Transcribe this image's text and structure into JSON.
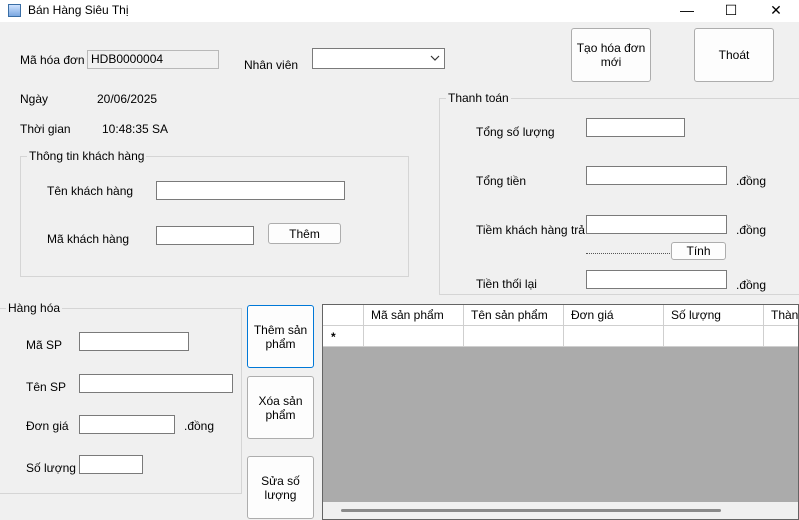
{
  "window": {
    "title": "Bán Hàng Siêu Thị",
    "minimize": "—",
    "maximize": "☐",
    "close": "✕"
  },
  "header": {
    "invoice_label": "Mã hóa đơn",
    "invoice_value": "HDB0000004",
    "staff_label": "Nhân viên",
    "staff_value": "",
    "date_label": "Ngày",
    "date_value": "20/06/2025",
    "time_label": "Thời gian",
    "time_value": "10:48:35 SA",
    "new_invoice_button": "Tạo hóa đơn mới",
    "exit_button": "Thoát"
  },
  "customer": {
    "group_title": "Thông tin khách hàng",
    "name_label": "Tên khách hàng",
    "name_value": "",
    "code_label": "Mã khách hàng",
    "code_value": "",
    "add_button": "Thêm"
  },
  "payment": {
    "group_title": "Thanh toán",
    "total_qty_label": "Tổng số lượng",
    "total_qty_value": "",
    "total_amount_label": "Tổng tiền",
    "total_amount_value": "",
    "paid_label": "Tiềm khách hàng trả",
    "paid_value": "",
    "calc_button": "Tính",
    "change_label": "Tiền thối lại",
    "change_value": "",
    "currency": ".đồng"
  },
  "goods": {
    "group_title": "Hàng hóa",
    "code_label": "Mã SP",
    "code_value": "",
    "name_label": "Tên SP",
    "name_value": "",
    "price_label": "Đơn giá",
    "price_value": "",
    "price_unit": ".đồng",
    "qty_label": "Số lượng",
    "qty_value": ""
  },
  "actions": {
    "add_product": "Thêm sản phẩm",
    "delete_product": "Xóa sản phẩm",
    "edit_quantity": "Sửa số lượng"
  },
  "grid": {
    "columns": [
      "Mã sản phẩm",
      "Tên sản phẩm",
      "Đơn giá",
      "Số lượng",
      "Thành tiền"
    ],
    "new_row_marker": "*"
  }
}
